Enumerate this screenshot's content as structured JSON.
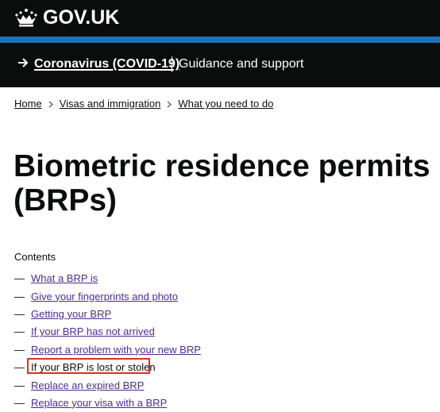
{
  "header": {
    "brand": "GOV.UK",
    "icon": "crown-icon",
    "colors": {
      "background": "#0b0c0c",
      "accent_bar": "#1d70b8"
    }
  },
  "banner": {
    "link_label": "Coronavirus (COVID-19)",
    "text": "Guidance and support",
    "icon": "arrow-right-icon"
  },
  "breadcrumb": {
    "items": [
      "Home",
      "Visas and immigration",
      "What you need to do"
    ]
  },
  "page": {
    "title": "Biometric residence permits (BRPs)"
  },
  "contents": {
    "label": "Contents",
    "dash": "—",
    "items": [
      {
        "label": "What a BRP is",
        "current": false
      },
      {
        "label": "Give your fingerprints and photo",
        "current": false
      },
      {
        "label": "Getting your BRP",
        "current": false
      },
      {
        "label": "If your BRP has not arrived",
        "current": false
      },
      {
        "label": "Report a problem with your new BRP",
        "current": false
      },
      {
        "label": "If your BRP is lost or stolen",
        "current": true
      },
      {
        "label": "Replace an expired BRP",
        "current": false
      },
      {
        "label": "Replace your visa with a BRP",
        "current": false
      }
    ],
    "colors": {
      "link": "#4c2c92",
      "highlight": "#d4351c"
    }
  }
}
